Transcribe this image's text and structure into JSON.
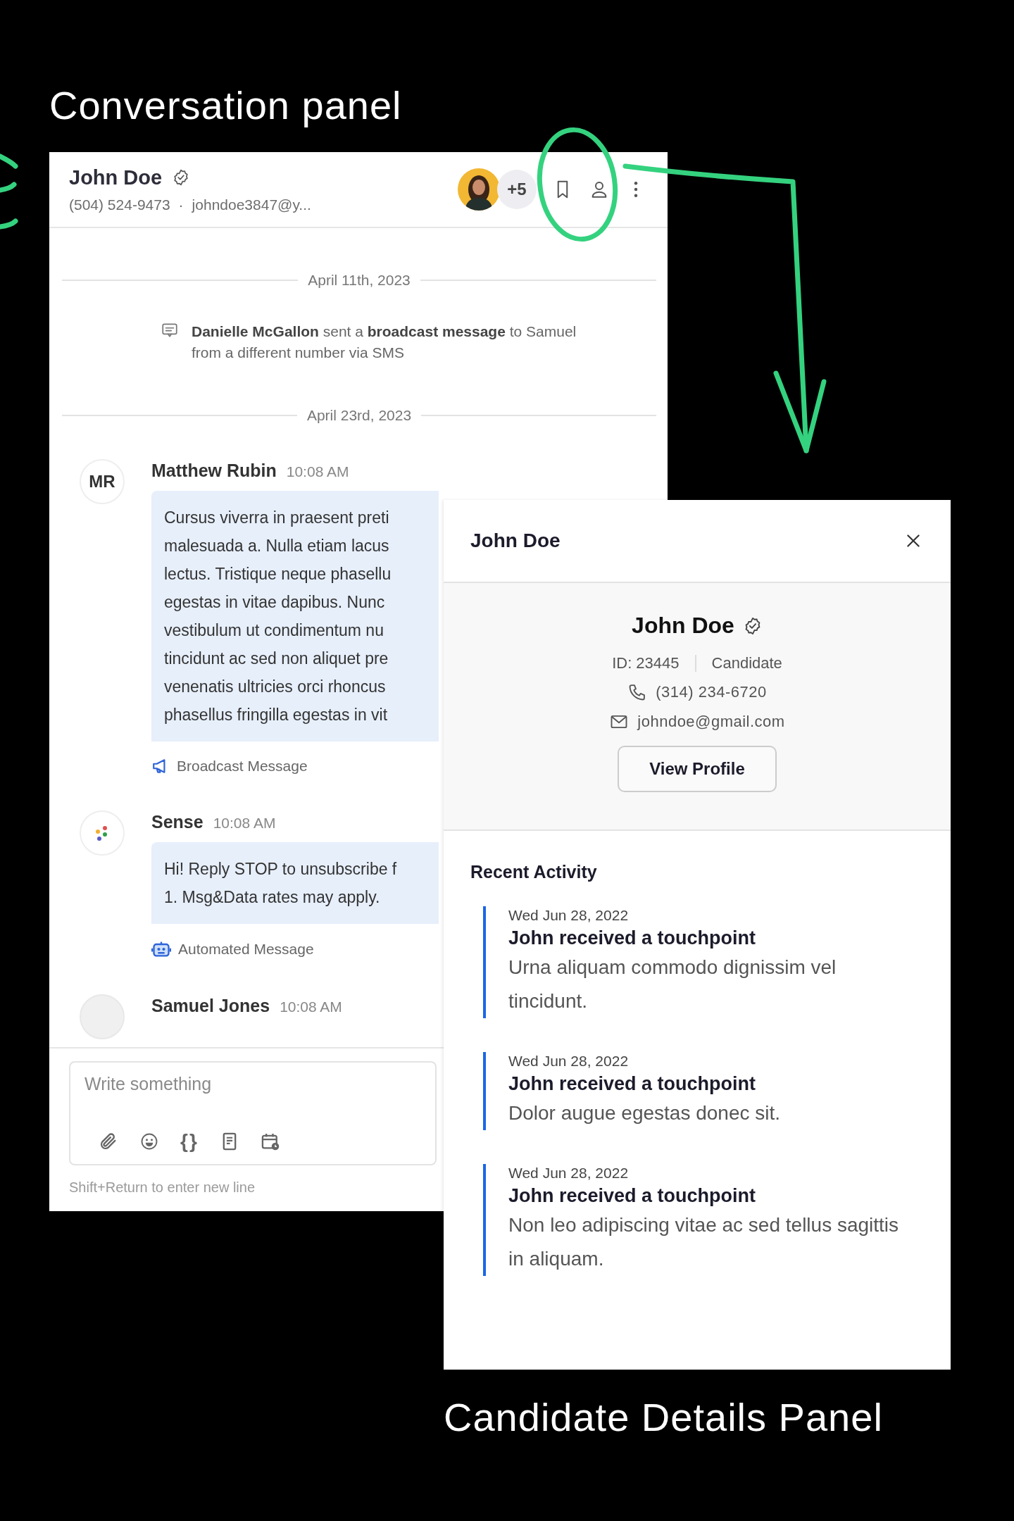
{
  "annotations": {
    "conversation_title": "Conversation panel",
    "details_title": "Candidate Details Panel"
  },
  "conversation": {
    "contact": {
      "name": "John Doe",
      "verified": true,
      "phone": "(504) 524-9473",
      "separator": "·",
      "email": "johndoe3847@y..."
    },
    "participants_more": "+5",
    "timeline": [
      {
        "kind": "date",
        "text": "April 11th, 2023"
      },
      {
        "kind": "event",
        "text": "**Danielle McGallon** sent a **broadcast message** to Samuel from a different number via SMS"
      },
      {
        "kind": "date",
        "text": "April 23rd, 2023"
      },
      {
        "kind": "message",
        "avatar": {
          "kind": "initials",
          "text": "MR"
        },
        "sender": "Matthew Rubin",
        "time": "10:08 AM",
        "lines": [
          "Cursus viverra in praesent preti",
          "malesuada a. Nulla etiam lacus",
          "lectus. Tristique neque phasellu",
          "egestas in vitae dapibus. Nunc",
          "vestibulum ut condimentum nu",
          "tincidunt ac sed non aliquet pre",
          "venenatis ultricies orci rhoncus",
          "phasellus fringilla egestas in vit"
        ],
        "footer": {
          "kind": "broadcast",
          "text": "Broadcast Message"
        }
      },
      {
        "kind": "message",
        "avatar": {
          "kind": "logo"
        },
        "sender": "Sense",
        "time": "10:08 AM",
        "lines": [
          "Hi! Reply STOP to unsubscribe f",
          "1. Msg&Data rates may apply."
        ],
        "footer": {
          "kind": "automated",
          "text": "Automated Message"
        }
      },
      {
        "kind": "message",
        "avatar": {
          "kind": "cut"
        },
        "sender": "Samuel Jones",
        "time": "10:08 AM"
      }
    ],
    "composer": {
      "placeholder": "Write something",
      "tools": [
        {
          "kind": "attach"
        },
        {
          "kind": "emoji"
        },
        {
          "kind": "variables",
          "text": "{}"
        },
        {
          "kind": "template"
        },
        {
          "kind": "schedule"
        }
      ],
      "hint": "Shift+Return to enter new line"
    }
  },
  "details": {
    "header_title": "John Doe",
    "profile": {
      "name": "John Doe",
      "verified": true,
      "id": "ID: 23445",
      "role": "Candidate",
      "phone": "(314) 234-6720",
      "email": "johndoe@gmail.com",
      "button": "View Profile"
    },
    "activity_title": "Recent Activity",
    "activity": [
      {
        "date": "Wed Jun 28, 2022",
        "title": "John received a touchpoint",
        "description": "Urna aliquam commodo dignissim vel tincidunt."
      },
      {
        "date": "Wed Jun 28, 2022",
        "title": "John received a touchpoint",
        "description": "Dolor augue egestas donec sit."
      },
      {
        "date": "Wed Jun 28, 2022",
        "title": "John received a touchpoint",
        "description": "Non leo adipiscing vitae ac sed tellus sagittis in aliquam."
      }
    ]
  }
}
